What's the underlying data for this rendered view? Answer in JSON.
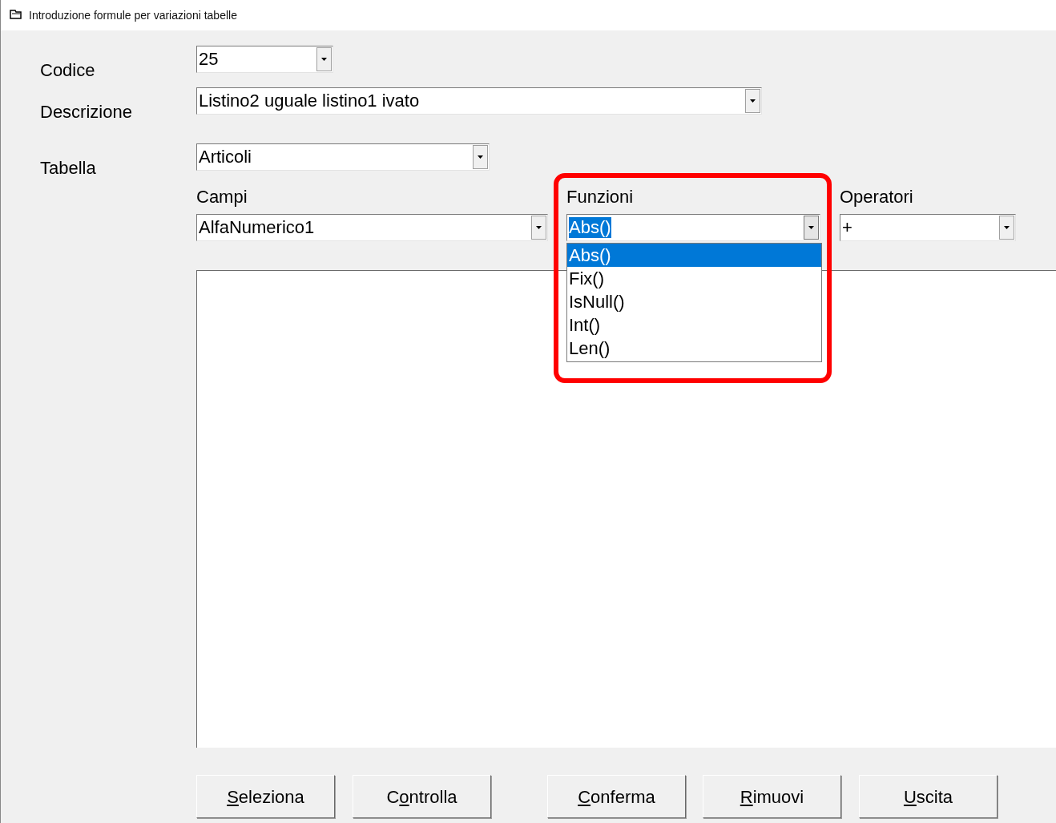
{
  "window": {
    "title": "Introduzione formule per variazioni tabelle"
  },
  "fields": [
    {
      "label": "Codice",
      "value": "25"
    },
    {
      "label": "Descrizione",
      "value": "Listino2 uguale listino1 ivato"
    },
    {
      "label": "Tabella",
      "value": "Articoli"
    }
  ],
  "pickers": [
    {
      "label": "Campi",
      "value": "AlfaNumerico1",
      "value_selected": false,
      "expanded": false
    },
    {
      "label": "Funzioni",
      "value": "Abs()",
      "value_selected": true,
      "expanded": true,
      "highlighted": true,
      "options": [
        {
          "text": "Abs()",
          "selected": true
        },
        {
          "text": "Fix()",
          "selected": false
        },
        {
          "text": "IsNull()",
          "selected": false
        },
        {
          "text": "Int()",
          "selected": false
        },
        {
          "text": "Len()",
          "selected": false
        }
      ]
    },
    {
      "label": "Operatori",
      "value": "+",
      "value_selected": false,
      "expanded": false
    }
  ],
  "buttons": [
    {
      "key": "S",
      "post": "eleziona"
    },
    {
      "pre": "C",
      "key": "o",
      "post": "ntrolla"
    },
    {
      "key": "C",
      "post": "onferma"
    },
    {
      "key": "R",
      "post": "imuovi"
    },
    {
      "key": "U",
      "post": "scita"
    }
  ]
}
